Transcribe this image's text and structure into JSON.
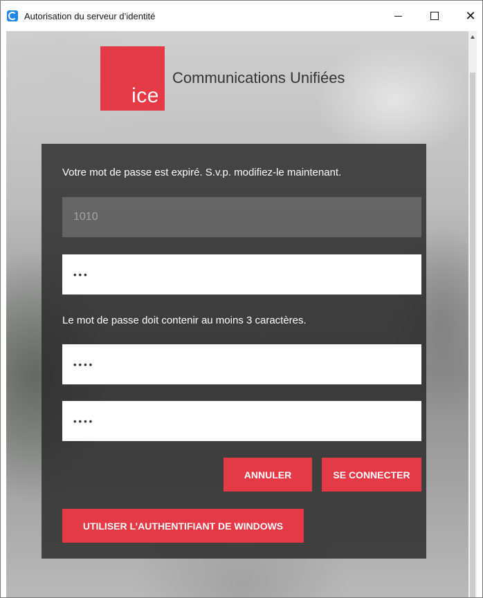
{
  "window": {
    "title": "Autorisation du serveur d’identité",
    "controls": {
      "minimize": "—",
      "maximize": "□",
      "close": "✕"
    }
  },
  "brand": {
    "logo_text": "ice",
    "name": "Communications Unifiées",
    "color": "#e63946"
  },
  "form": {
    "message_expired": "Votre mot de passe est expiré. S.v.p. modifiez-le maintenant.",
    "username_value": "1010",
    "old_password_value": "•••",
    "password_rule": "Le mot de passe doit contenir au moins 3 caractères.",
    "new_password_value": "••••",
    "confirm_password_value": "••••"
  },
  "buttons": {
    "cancel": "ANNULER",
    "connect": "SE CONNECTER",
    "windows_auth": "UTILISER L’AUTHENTIFIANT DE WINDOWS"
  },
  "icons": {
    "app": "identity-app-icon",
    "minimize": "minimize-icon",
    "maximize": "maximize-icon",
    "close": "close-icon"
  }
}
